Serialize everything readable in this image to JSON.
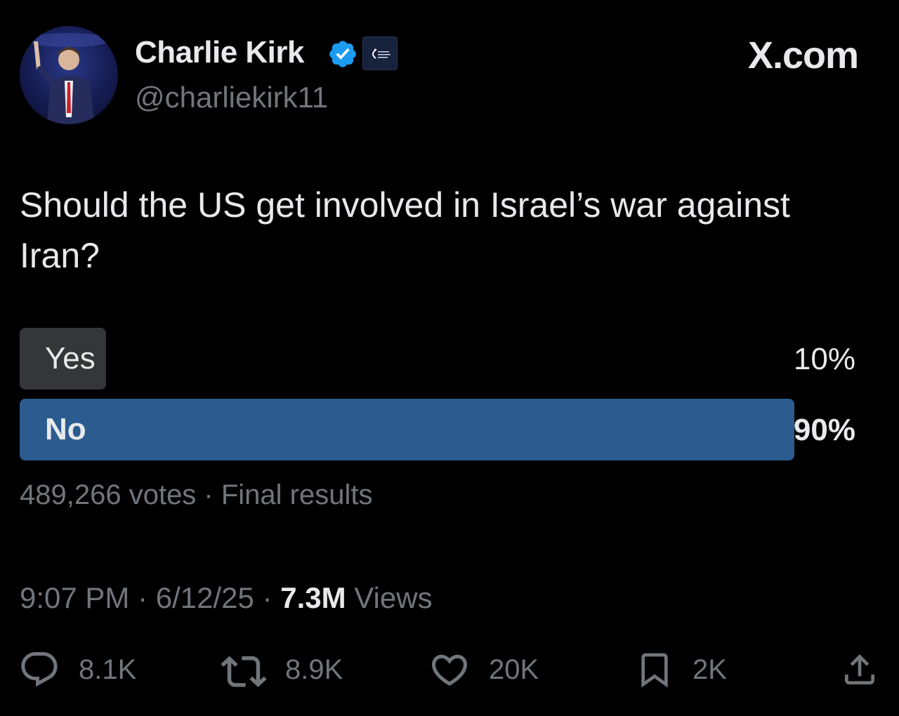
{
  "author": {
    "display_name": "Charlie Kirk",
    "handle": "@charliekirk11",
    "verified_icon": "verified-badge-icon",
    "affiliate_badge": "turning-point-usa-logo"
  },
  "site_logo": "X.com",
  "tweet": {
    "text": "Should the US get involved in Israel’s war against Iran?"
  },
  "poll": {
    "options": [
      {
        "label": "Yes",
        "percent_text": "10%",
        "percent": 10,
        "winner": false
      },
      {
        "label": "No",
        "percent_text": "90%",
        "percent": 90,
        "winner": true
      }
    ],
    "meta": "489,266 votes · Final results"
  },
  "timestamp": {
    "time": "9:07 PM",
    "date": "6/12/25",
    "sep": "·",
    "views_count": "7.3M",
    "views_label": "Views"
  },
  "actions": {
    "reply": {
      "icon": "reply-icon",
      "count": "8.1K"
    },
    "retweet": {
      "icon": "retweet-icon",
      "count": "8.9K"
    },
    "like": {
      "icon": "heart-icon",
      "count": "20K"
    },
    "bookmark": {
      "icon": "bookmark-icon",
      "count": "2K"
    },
    "share": {
      "icon": "share-icon"
    }
  },
  "colors": {
    "background": "#000000",
    "text_primary": "#e7e9ea",
    "text_secondary": "#71767b",
    "poll_winner_bar": "#2b5b8f",
    "poll_other_bar": "#343638",
    "verified_blue": "#1d9bf0"
  }
}
